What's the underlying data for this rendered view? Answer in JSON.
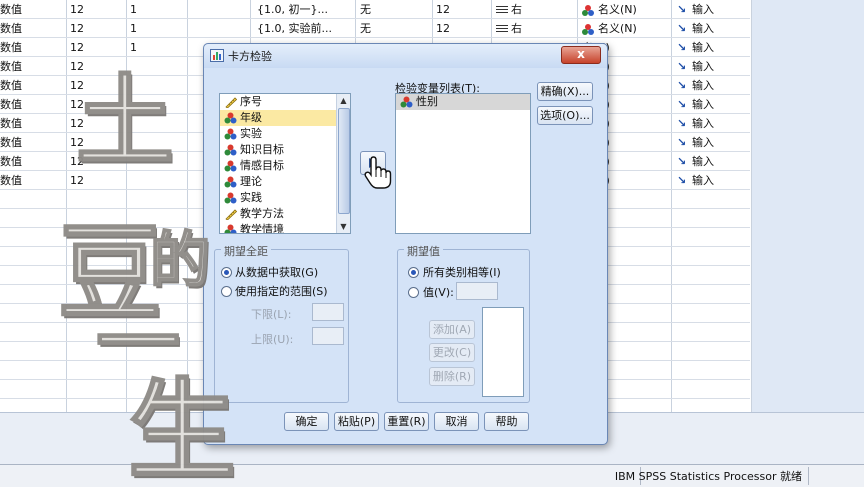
{
  "grid": {
    "rows": [
      {
        "type": "数值",
        "width": "12",
        "dec": "1",
        "values": "{1.0, 初一}...",
        "missing": "无",
        "cols": "12",
        "align": "右",
        "measure": "名义(N)",
        "role": "输入"
      },
      {
        "type": "数值",
        "width": "12",
        "dec": "1",
        "values": "{1.0, 实验前...",
        "missing": "无",
        "cols": "12",
        "align": "右",
        "measure": "名义(N)",
        "role": "输入"
      },
      {
        "type": "数值",
        "width": "12",
        "dec": "1",
        "values": "",
        "missing": "",
        "cols": "",
        "align": "",
        "measure": "义(N)",
        "role": "输入"
      },
      {
        "type": "数值",
        "width": "12",
        "dec": "",
        "values": "",
        "missing": "",
        "cols": "",
        "align": "",
        "measure": "义(N)",
        "role": "输入"
      },
      {
        "type": "数值",
        "width": "12",
        "dec": "",
        "values": "",
        "missing": "",
        "cols": "",
        "align": "",
        "measure": "义(N)",
        "role": "输入"
      },
      {
        "type": "数值",
        "width": "12",
        "dec": "",
        "values": "",
        "missing": "",
        "cols": "",
        "align": "",
        "measure": "义(N)",
        "role": "输入"
      },
      {
        "type": "数值",
        "width": "12",
        "dec": "",
        "values": "",
        "missing": "",
        "cols": "",
        "align": "",
        "measure": "义(N)",
        "role": "输入"
      },
      {
        "type": "数值",
        "width": "12",
        "dec": "",
        "values": "",
        "missing": "",
        "cols": "",
        "align": "",
        "measure": "义(N)",
        "role": "输入"
      },
      {
        "type": "数值",
        "width": "12",
        "dec": "",
        "values": "",
        "missing": "",
        "cols": "",
        "align": "",
        "measure": "义(N)",
        "role": "输入"
      },
      {
        "type": "数值",
        "width": "12",
        "dec": "",
        "values": "",
        "missing": "",
        "cols": "",
        "align": "",
        "measure": "义(N)",
        "role": "输入"
      }
    ]
  },
  "status": {
    "processor": "IBM SPSS Statistics Processor 就绪"
  },
  "dialog": {
    "title": "卡方检验",
    "close": "x",
    "source_vars": [
      "序号",
      "年级",
      "实验",
      "知识目标",
      "情感目标",
      "理论",
      "实践",
      "教学方法",
      "教学情境"
    ],
    "target_label": "检验变量列表(T):",
    "target_vars": [
      "性别"
    ],
    "buttons": {
      "exact": "精确(X)...",
      "options": "选项(O)...",
      "add": "添加(A)",
      "change": "更改(C)",
      "remove": "删除(R)"
    },
    "range": {
      "title": "期望全距",
      "from_data": "从数据中获取(G)",
      "use_range": "使用指定的范围(S)",
      "lower": "下限(L):",
      "upper": "上限(U):"
    },
    "expected": {
      "title": "期望值",
      "all_equal": "所有类别相等(I)",
      "values": "值(V):"
    },
    "footer": {
      "ok": "确定",
      "paste": "粘贴(P)",
      "reset": "重置(R)",
      "cancel": "取消",
      "help": "帮助"
    }
  },
  "watermark": [
    "土",
    "豆",
    "的",
    "一",
    "生"
  ]
}
